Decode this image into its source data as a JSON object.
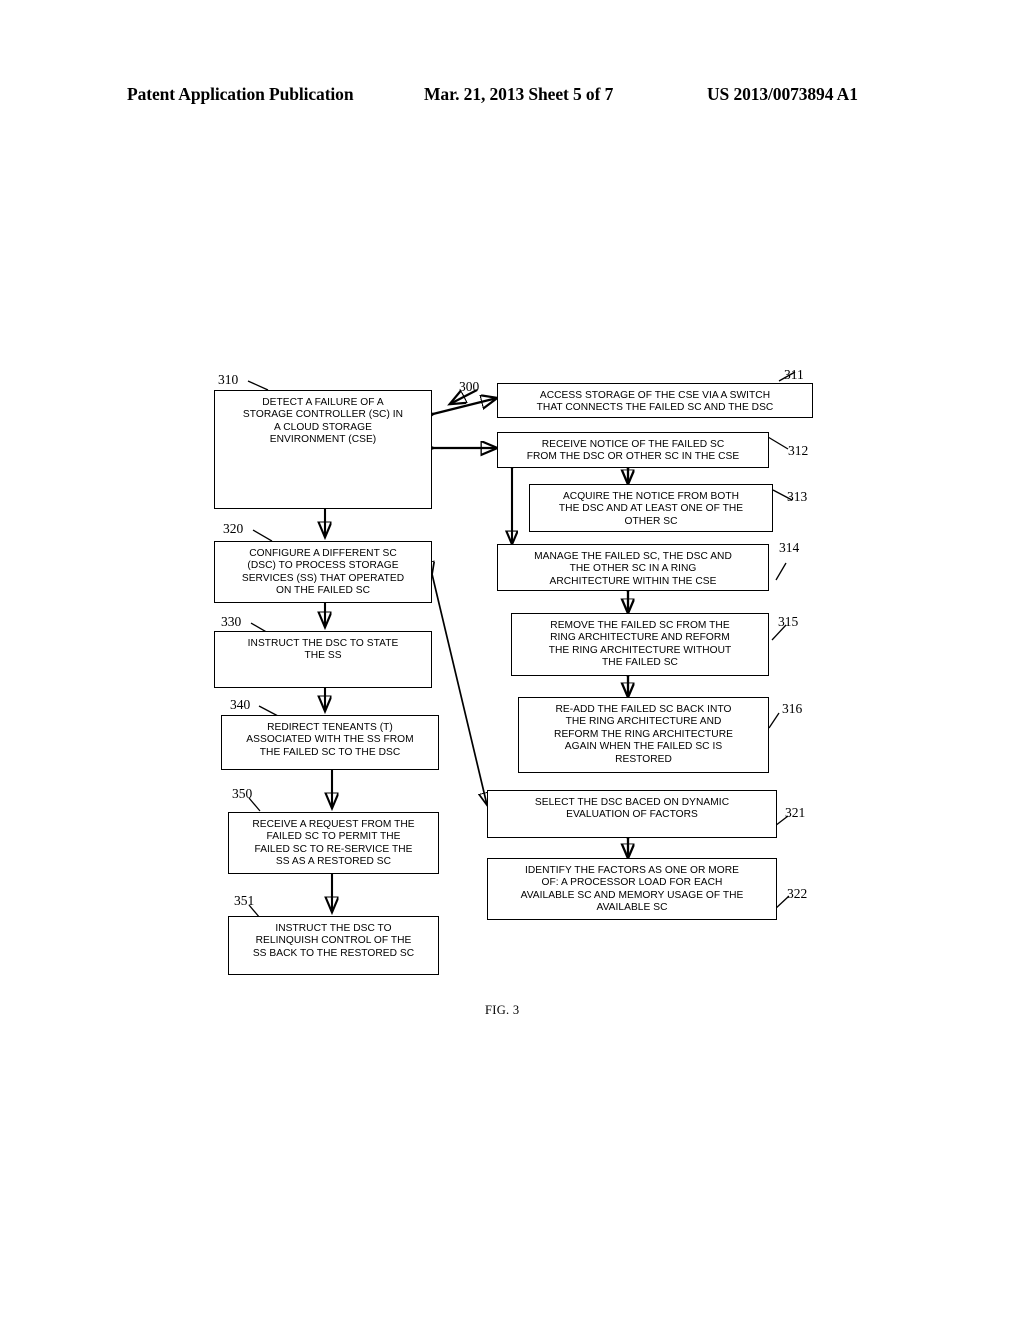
{
  "header": {
    "left": "Patent Application Publication",
    "middle": "Mar. 21, 2013  Sheet 5 of 7",
    "right": "US 2013/0073894 A1"
  },
  "figure": {
    "caption": "FIG. 3",
    "diagram_ref": "300"
  },
  "boxes": {
    "b310": {
      "ref": "310",
      "text": "DETECT A FAILURE OF A\nSTORAGE CONTROLLER (SC) IN\nA CLOUD STORAGE\nENVIRONMENT (CSE)"
    },
    "b320": {
      "ref": "320",
      "text": "CONFIGURE A DIFFERENT SC\n(DSC) TO PROCESS STORAGE\nSERVICES (SS) THAT OPERATED\nON THE FAILED SC"
    },
    "b330": {
      "ref": "330",
      "text": "INSTRUCT THE DSC TO STATE\nTHE SS"
    },
    "b340": {
      "ref": "340",
      "text": "REDIRECT TENEANTS (T)\nASSOCIATED WITH THE SS FROM\nTHE FAILED SC TO THE DSC"
    },
    "b350": {
      "ref": "350",
      "text": "RECEIVE A REQUEST FROM THE\nFAILED SC TO PERMIT THE\nFAILED SC TO RE-SERVICE THE\nSS AS A RESTORED SC"
    },
    "b351": {
      "ref": "351",
      "text": "INSTRUCT THE DSC TO\nRELINQUISH CONTROL OF THE\nSS BACK TO THE RESTORED SC"
    },
    "b311": {
      "ref": "311",
      "text": "ACCESS STORAGE OF THE CSE VIA A SWITCH\nTHAT CONNECTS THE FAILED SC AND THE DSC"
    },
    "b312": {
      "ref": "312",
      "text": "RECEIVE NOTICE OF THE FAILED SC\nFROM THE DSC OR OTHER SC IN THE CSE"
    },
    "b313": {
      "ref": "313",
      "text": "ACQUIRE THE NOTICE FROM BOTH\nTHE DSC AND AT LEAST ONE OF THE\nOTHER SC"
    },
    "b314": {
      "ref": "314",
      "text": "MANAGE THE FAILED SC, THE DSC AND\nTHE OTHER SC IN A RING\nARCHITECTURE WITHIN THE CSE"
    },
    "b315": {
      "ref": "315",
      "text": "REMOVE THE FAILED SC FROM THE\nRING ARCHITECTURE AND REFORM\nTHE RING ARCHITECTURE WITHOUT\nTHE FAILED SC"
    },
    "b316": {
      "ref": "316",
      "text": "RE-ADD THE FAILED SC BACK INTO\nTHE RING ARCHITECTURE AND\nREFORM THE RING ARCHITECTURE\nAGAIN WHEN THE FAILED SC IS\nRESTORED"
    },
    "b321": {
      "ref": "321",
      "text": "SELECT THE DSC BACED ON DYNAMIC\nEVALUATION OF FACTORS"
    },
    "b322": {
      "ref": "322",
      "text": "IDENTIFY THE FACTORS AS ONE OR MORE\nOF: A PROCESSOR LOAD FOR EACH\nAVAILABLE SC AND MEMORY USAGE OF THE\nAVAILABLE SC"
    }
  }
}
